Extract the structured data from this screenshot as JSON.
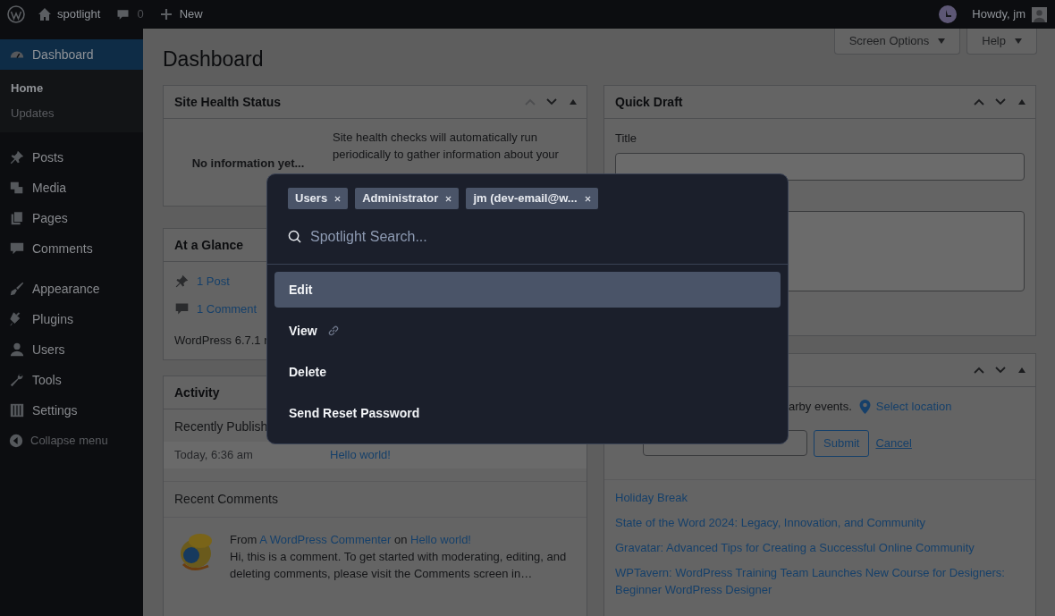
{
  "admin_bar": {
    "site_name": "spotlight",
    "comment_count": "0",
    "new_label": "New",
    "greeting": "Howdy, jm"
  },
  "sidebar": {
    "sections": [
      {
        "items": [
          {
            "label": "Dashboard",
            "selected": true,
            "children": [
              {
                "label": "Home",
                "selected": true
              },
              {
                "label": "Updates",
                "selected": false
              }
            ]
          }
        ]
      },
      {
        "items": [
          {
            "label": "Posts",
            "selected": false
          },
          {
            "label": "Media",
            "selected": false
          },
          {
            "label": "Pages",
            "selected": false
          },
          {
            "label": "Comments",
            "selected": false
          }
        ]
      },
      {
        "items": [
          {
            "label": "Appearance",
            "selected": false
          },
          {
            "label": "Plugins",
            "selected": false
          },
          {
            "label": "Users",
            "selected": false
          },
          {
            "label": "Tools",
            "selected": false
          },
          {
            "label": "Settings",
            "selected": false
          }
        ]
      }
    ],
    "collapse_label": "Collapse menu"
  },
  "screen_meta_buttons": [
    "Screen Options",
    "Help"
  ],
  "page_title": "Dashboard",
  "site_health": {
    "title": "Site Health Status",
    "up_disabled": true,
    "status": "No information yet...",
    "text": "Site health checks will automatically run periodically to gather information about your"
  },
  "at_a_glance": {
    "title": "At a Glance",
    "items": [
      "1 Post",
      "1 Comment"
    ],
    "version": "WordPress 6.7.1 r"
  },
  "activity": {
    "title": "Activity",
    "recently_published": "Recently Publish",
    "posts": [
      {
        "date": "Today, 6:36 am",
        "title": "Hello world!"
      }
    ],
    "recent_comments": "Recent Comments",
    "comments": [
      {
        "from": "From",
        "author": "A WordPress Commenter",
        "on": "on",
        "post": "Hello world!",
        "text": "Hi, this is a comment. To get started with moderating, editing, and deleting comments, please visit the Comments screen in…"
      }
    ]
  },
  "quick_draft": {
    "title": "Quick Draft",
    "up_disabled": false,
    "title_label": "Title"
  },
  "events": {
    "up_disabled": false,
    "intro": "arby events.",
    "select_location": "Select location",
    "submit": "Submit",
    "cancel": "Cancel",
    "news": [
      "Holiday Break",
      "State of the Word 2024: Legacy, Innovation, and Community",
      "Gravatar: Advanced Tips for Creating a Successful Online Community",
      "WPTavern: WordPress Training Team Launches New Course for Designers: Beginner WordPress Designer"
    ]
  },
  "spotlight": {
    "chips": [
      "Users",
      "Administrator",
      "jm (dev-email@w..."
    ],
    "search_placeholder": "Spotlight Search...",
    "actions": [
      {
        "label": "Edit",
        "selected": true,
        "kind": "action"
      },
      {
        "label": "View",
        "selected": false,
        "kind": "link"
      },
      {
        "label": "Delete",
        "selected": false,
        "kind": "action"
      },
      {
        "label": "Send Reset Password",
        "selected": false,
        "kind": "action"
      }
    ]
  }
}
